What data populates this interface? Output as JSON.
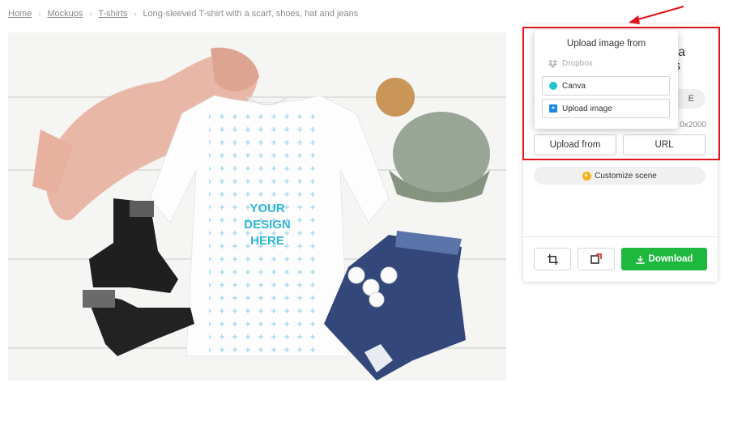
{
  "breadcrumb": {
    "items": [
      "Home",
      "Mockups",
      "T-shirts"
    ],
    "current": "Long-sleeved T-shirt with a scarf, shoes, hat and jeans"
  },
  "mockup": {
    "design_placeholder": [
      "YOUR",
      "DESIGN",
      "HERE"
    ]
  },
  "panel": {
    "title_fragment_1": "a",
    "title_fragment_2": "s",
    "button_fragment": "E",
    "dimension_fragment": "0x2000",
    "upload_from_label": "Upload from",
    "url_label": "URL",
    "customize_label": "Customize scene",
    "download_label": "Download"
  },
  "dropdown": {
    "title": "Upload image from",
    "dropbox_label": "Dropbox",
    "canva_label": "Canva",
    "upload_label": "Upload image"
  },
  "colors": {
    "download_green": "#1fb83f",
    "highlight_red": "#e3151c",
    "canva_teal": "#23c4ce"
  }
}
